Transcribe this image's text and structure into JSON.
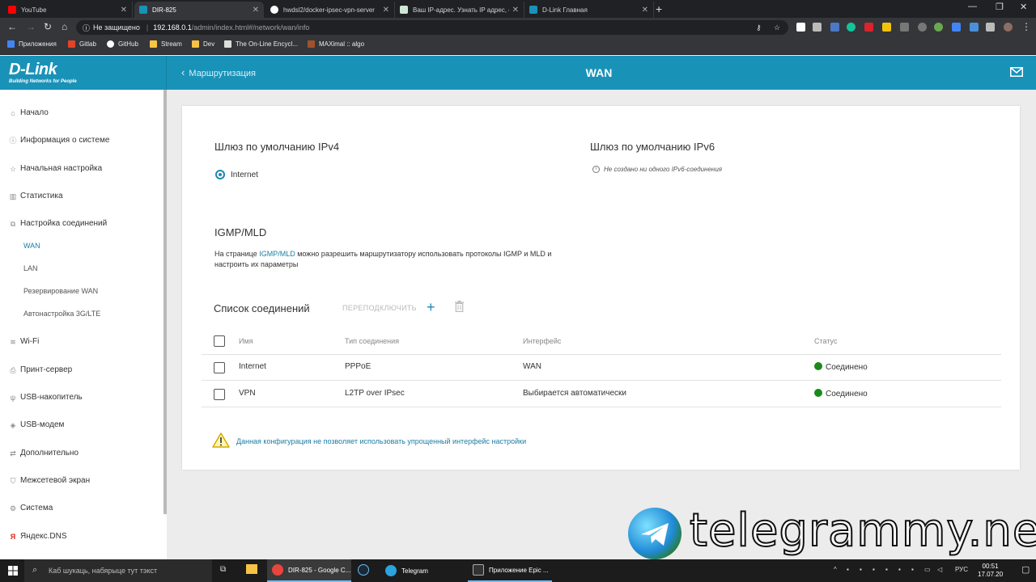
{
  "browser": {
    "tabs": [
      {
        "title": "YouTube",
        "color": "#ff0000"
      },
      {
        "title": "DIR-825",
        "color": "#1992b8"
      },
      {
        "title": "hwdsl2/docker-ipsec-vpn-server",
        "color": "#ffffff"
      },
      {
        "title": "Ваш IP-адрес. Узнать IP адрес, с",
        "color": "#cfe8d6"
      },
      {
        "title": "D-Link Главная",
        "color": "#1992b8"
      }
    ],
    "address": {
      "security": "Не защищено",
      "host": "192.168.0.1",
      "path": "/admin/index.html#/network/wan/info"
    },
    "bookmarks": [
      {
        "label": "Приложения",
        "icon": "apps-grid-icon"
      },
      {
        "label": "Gitlab",
        "icon": "gitlab-icon"
      },
      {
        "label": "GitHub",
        "icon": "github-icon"
      },
      {
        "label": "Stream",
        "icon": "folder-icon"
      },
      {
        "label": "Dev",
        "icon": "folder-icon"
      },
      {
        "label": "The On-Line Encycl...",
        "icon": "bookmark-icon"
      },
      {
        "label": "MAXimal :: algo",
        "icon": "bookmark-icon"
      }
    ]
  },
  "app": {
    "brand": "D-Link",
    "brand_tagline": "Building Networks for People",
    "back_label": "Маршрутизация",
    "title": "WAN",
    "sidebar": {
      "items": [
        {
          "label": "Начало",
          "icon": "home-icon"
        },
        {
          "label": "Информация о системе",
          "icon": "info-icon"
        },
        {
          "label": "Начальная настройка",
          "icon": "star-icon"
        },
        {
          "label": "Статистика",
          "icon": "stats-icon"
        },
        {
          "label": "Настройка соединений",
          "icon": "connections-icon"
        }
      ],
      "sub": [
        "WAN",
        "LAN",
        "Резервирование WAN",
        "Автонастройка 3G/LTE"
      ],
      "items2": [
        {
          "label": "Wi-Fi",
          "icon": "wifi-icon"
        },
        {
          "label": "Принт-сервер",
          "icon": "printer-icon"
        },
        {
          "label": "USB-накопитель",
          "icon": "usb-icon"
        },
        {
          "label": "USB-модем",
          "icon": "usb-modem-icon"
        },
        {
          "label": "Дополнительно",
          "icon": "arrows-icon"
        },
        {
          "label": "Межсетевой экран",
          "icon": "shield-icon"
        },
        {
          "label": "Система",
          "icon": "gear-icon"
        },
        {
          "label": "Яндекс.DNS",
          "icon": "yandex-icon"
        }
      ]
    },
    "ipv4": {
      "title": "Шлюз по умолчанию IPv4",
      "option": "Internet"
    },
    "ipv6": {
      "title": "Шлюз по умолчанию IPv6",
      "note": "Не создано ни одного IPv6-соединения"
    },
    "igmp": {
      "title": "IGMP/MLD",
      "desc_before": "На странице ",
      "desc_link": "IGMP/MLD",
      "desc_after": " можно разрешить маршрутизатору использовать протоколы IGMP и MLD и настроить их параметры"
    },
    "connections": {
      "title": "Список соединений",
      "reconnect_label": "ПЕРЕПОДКЛЮЧИТЬ",
      "columns": [
        "Имя",
        "Тип соединения",
        "Интерфейс",
        "Статус"
      ],
      "rows": [
        {
          "name": "Internet",
          "type": "PPPoE",
          "iface": "WAN",
          "status": "Соединено"
        },
        {
          "name": "VPN",
          "type": "L2TP over IPsec",
          "iface": "Выбирается автоматически",
          "status": "Соединено"
        }
      ],
      "status_color": "#1a8a1a"
    },
    "warning": "Данная конфигурация не позволяет использовать упрощенный интерфейс настройки"
  },
  "watermark": "telegrammy.net",
  "taskbar": {
    "search_placeholder": "Каб шукаць, набярыце тут тэкст",
    "apps": [
      {
        "label": "DIR-825 - Google C...",
        "color": "#e8453c"
      },
      {
        "label": "Telegram",
        "color": "#2aa3df"
      },
      {
        "label": "Приложение Epic ...",
        "color": "#333333"
      }
    ],
    "lang": "РУС",
    "time": "00:51",
    "date": "17.07.20"
  }
}
